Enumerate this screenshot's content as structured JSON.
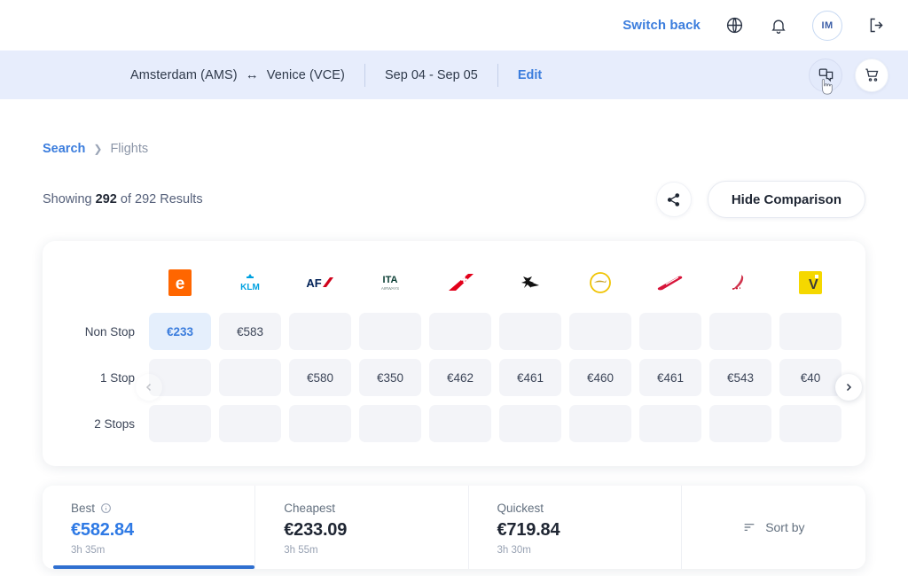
{
  "topbar": {
    "switch_back": "Switch back",
    "globe_icon": "globe-icon",
    "bell_icon": "bell-icon",
    "avatar_initials": "IM",
    "logout_icon": "logout-icon"
  },
  "searchband": {
    "origin": "Amsterdam (AMS)",
    "swap_symbol": "↔",
    "destination": "Venice (VCE)",
    "dates": "Sep 04 - Sep 05",
    "edit_label": "Edit",
    "compare_icon": "compare-chat-icon",
    "cart_icon": "shopping-cart-icon",
    "band_color": "#e7edfc"
  },
  "breadcrumb": {
    "root": "Search",
    "separator": "❯",
    "current": "Flights"
  },
  "results": {
    "prefix": "Showing",
    "count": "292",
    "middle": "of 292 Results",
    "share_icon": "share-icon",
    "hide_comparison": "Hide Comparison"
  },
  "matrix": {
    "airlines": [
      {
        "name": "easyjet",
        "code": "e"
      },
      {
        "name": "klm",
        "code": "KLM"
      },
      {
        "name": "air-france",
        "code": "AF"
      },
      {
        "name": "ita-airways",
        "code": "ITA"
      },
      {
        "name": "swiss",
        "code": "LX"
      },
      {
        "name": "brussels-airlines",
        "code": "SN"
      },
      {
        "name": "lufthansa",
        "code": "LH"
      },
      {
        "name": "austrian-airlines",
        "code": "OS"
      },
      {
        "name": "iberia",
        "code": "IB"
      },
      {
        "name": "vueling",
        "code": "VY"
      }
    ],
    "rows": [
      {
        "label": "Non Stop",
        "prices": [
          "€233",
          "€583",
          "",
          "",
          "",
          "",
          "",
          "",
          "",
          ""
        ],
        "selected_index": 0
      },
      {
        "label": "1 Stop",
        "prices": [
          "",
          "",
          "€580",
          "€350",
          "€462",
          "€461",
          "€460",
          "€461",
          "€543",
          "€40"
        ],
        "selected_index": -1
      },
      {
        "label": "2 Stops",
        "prices": [
          "",
          "",
          "",
          "",
          "",
          "",
          "",
          "",
          "",
          ""
        ],
        "selected_index": -1
      }
    ],
    "prev_icon": "chevron-left-icon",
    "next_icon": "chevron-right-icon",
    "accent_color": "#3b7ddd"
  },
  "tabs": [
    {
      "label": "Best",
      "price": "€582.84",
      "duration": "3h 35m",
      "active": true,
      "info_icon": "info-icon"
    },
    {
      "label": "Cheapest",
      "price": "€233.09",
      "duration": "3h 55m",
      "active": false,
      "info_icon": ""
    },
    {
      "label": "Quickest",
      "price": "€719.84",
      "duration": "3h 30m",
      "active": false,
      "info_icon": ""
    }
  ],
  "sort": {
    "label": "Sort by",
    "icon": "sort-icon"
  }
}
